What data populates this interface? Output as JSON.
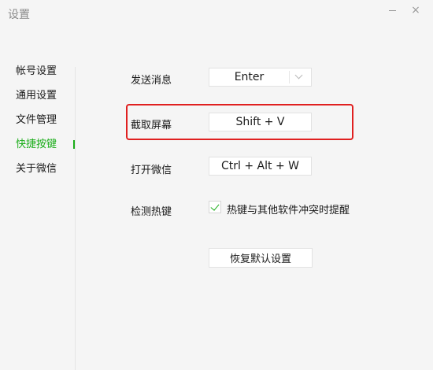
{
  "window": {
    "title": "设置",
    "minimize_icon": "minimize-icon",
    "close_icon": "close-icon",
    "close_glyph": "×"
  },
  "sidebar": {
    "items": [
      {
        "label": "帐号设置",
        "active": false
      },
      {
        "label": "通用设置",
        "active": false
      },
      {
        "label": "文件管理",
        "active": false
      },
      {
        "label": "快捷按键",
        "active": true
      },
      {
        "label": "关于微信",
        "active": false
      }
    ]
  },
  "shortcuts": {
    "send_message": {
      "label": "发送消息",
      "value": "Enter"
    },
    "screenshot": {
      "label": "截取屏幕",
      "value": "Shift + V"
    },
    "open_wechat": {
      "label": "打开微信",
      "value": "Ctrl + Alt + W"
    },
    "detect_hotkey": {
      "label": "检测热键",
      "checkbox_label": "热键与其他软件冲突时提醒",
      "checked": true
    },
    "reset_label": "恢复默认设置"
  },
  "colors": {
    "accent": "#1aad19",
    "highlight": "#e02020",
    "background": "#f5f5f5"
  }
}
